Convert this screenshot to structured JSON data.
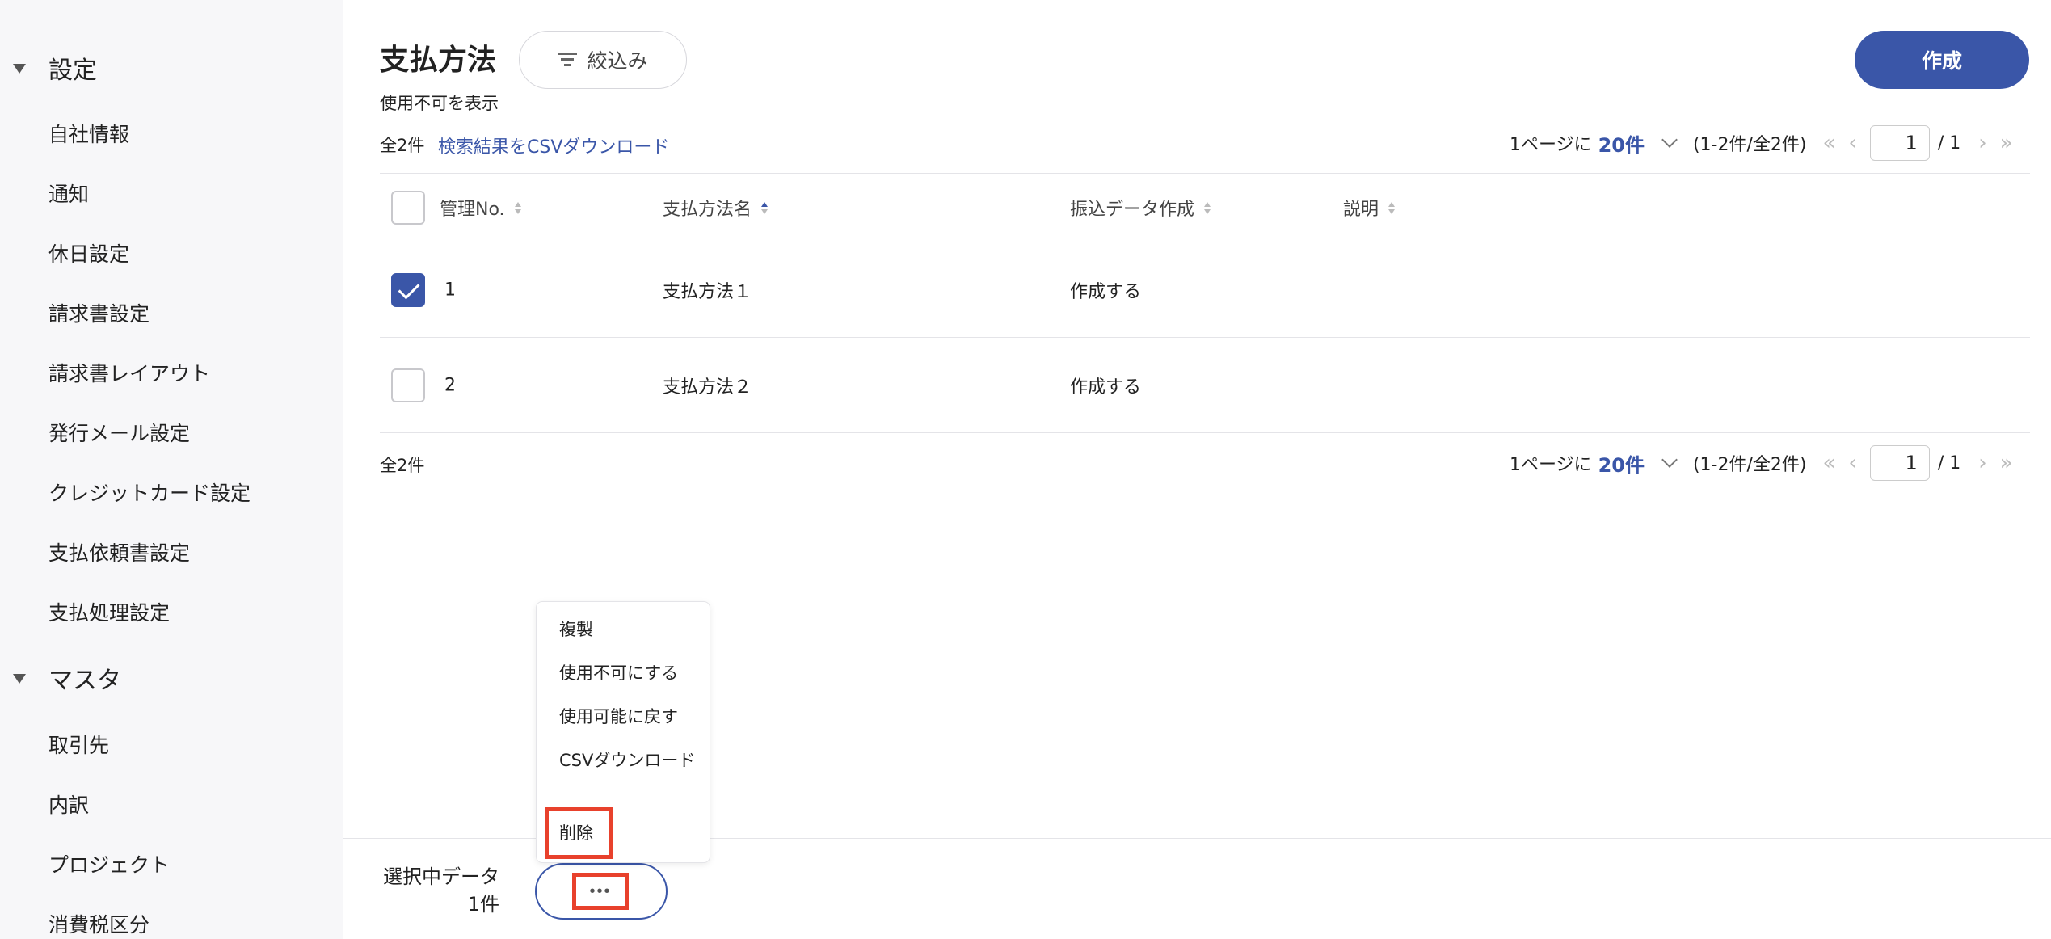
{
  "sidebar": {
    "sections": [
      {
        "label": "設定",
        "items": [
          "自社情報",
          "通知",
          "休日設定",
          "請求書設定",
          "請求書レイアウト",
          "発行メール設定",
          "クレジットカード設定",
          "支払依頼書設定",
          "支払処理設定"
        ]
      },
      {
        "label": "マスタ",
        "items": [
          "取引先",
          "内訳",
          "プロジェクト",
          "消費税区分"
        ]
      }
    ]
  },
  "header": {
    "title": "支払方法",
    "filter_label": "絞込み",
    "show_disabled": "使用不可を表示",
    "create_label": "作成"
  },
  "summary": {
    "count_label": "全2件",
    "csv_link": "検索結果をCSVダウンロード"
  },
  "pagination": {
    "per_page_label": "1ページに",
    "per_page_value": "20件",
    "range": "(1-2件/全2件)",
    "first": "«",
    "prev": "‹",
    "next": "›",
    "last": "»",
    "current_page": "1",
    "total_pages": "/ 1"
  },
  "table": {
    "columns": [
      "管理No.",
      "支払方法名",
      "振込データ作成",
      "説明"
    ],
    "rows": [
      {
        "no": "1",
        "name": "支払方法１",
        "transfer": "作成する",
        "description": "",
        "checked": true
      },
      {
        "no": "2",
        "name": "支払方法２",
        "transfer": "作成する",
        "description": "",
        "checked": false
      }
    ]
  },
  "bottom_bar": {
    "selected_label": "選択中データ",
    "selected_count": "1件",
    "more_label": "•••"
  },
  "menu": {
    "items": [
      "複製",
      "使用不可にする",
      "使用可能に戻す",
      "CSVダウンロード",
      "削除"
    ]
  },
  "colors": {
    "accent": "#3a56a8",
    "highlight": "#e8412c",
    "sidebar_bg": "#f7f7f9"
  }
}
